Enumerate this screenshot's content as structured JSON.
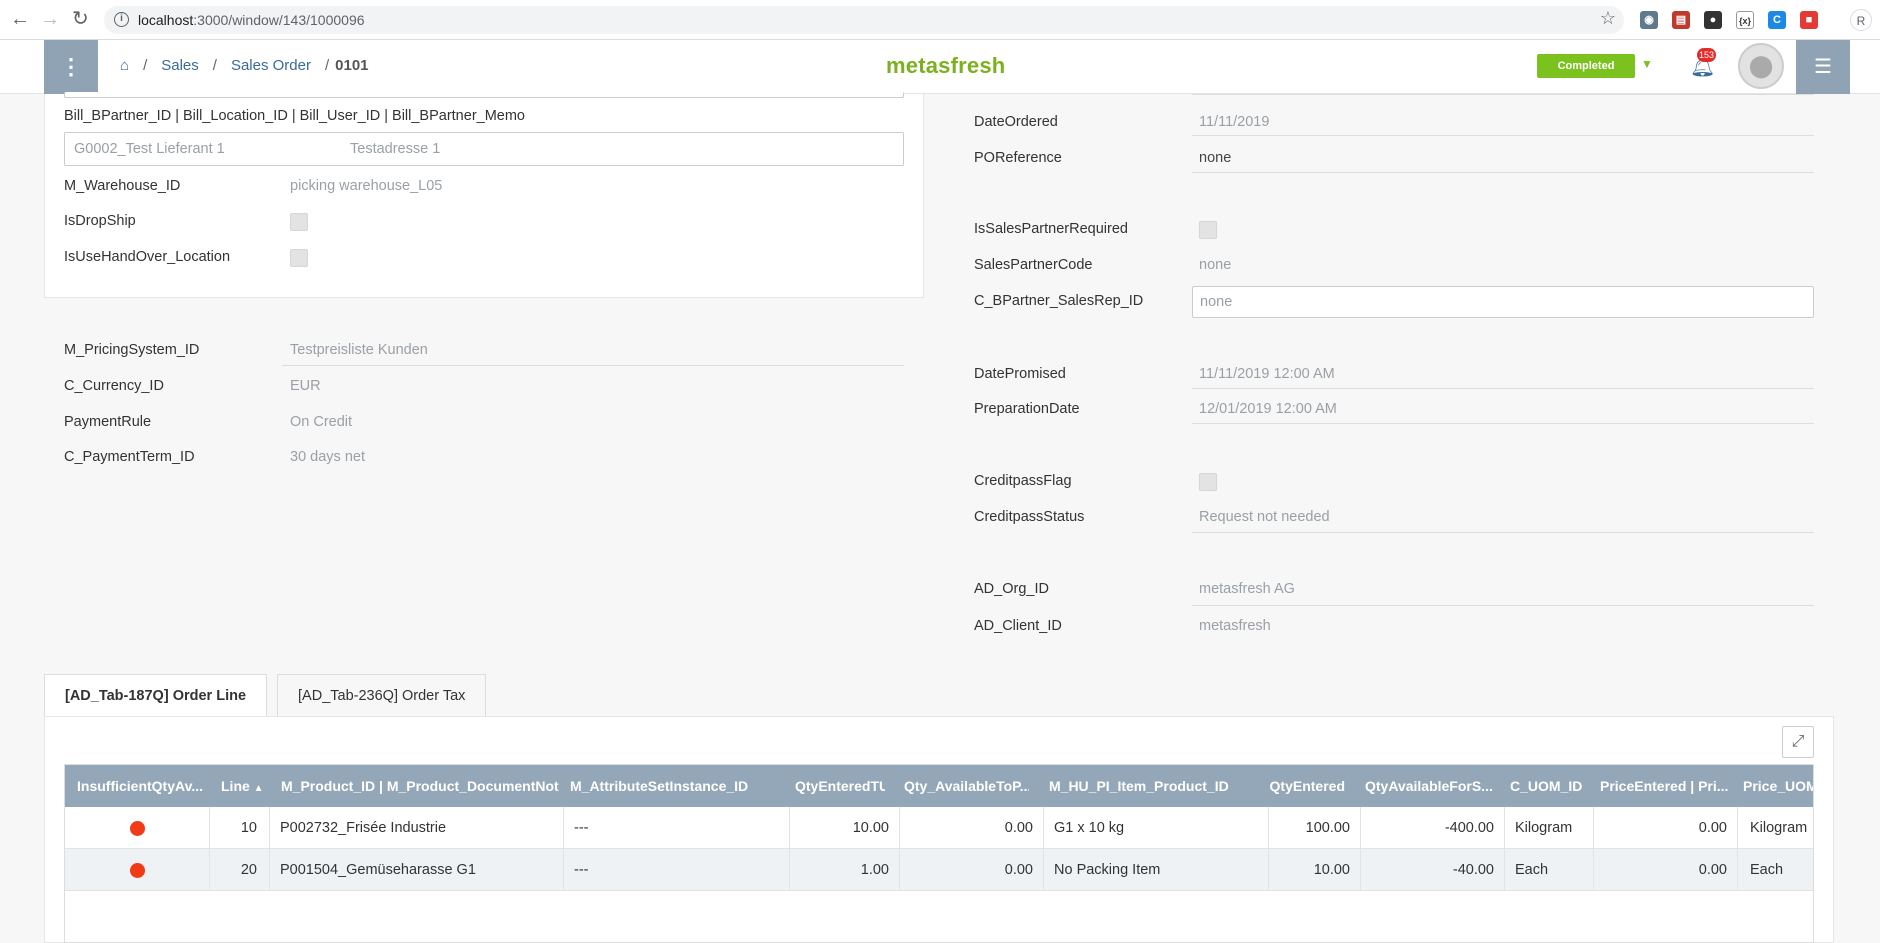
{
  "browser": {
    "url_host": "localhost",
    "url_path": ":3000/window/143/1000096",
    "profile_initial": "R"
  },
  "header": {
    "breadcrumb": [
      "Sales",
      "Sales Order"
    ],
    "record": "0101",
    "logo": "metasfresh",
    "status": "Completed",
    "notification_count": "153"
  },
  "left_form": {
    "bill_label": "Bill_BPartner_ID | Bill_Location_ID | Bill_User_ID | Bill_BPartner_Memo",
    "bill_partner": "G0002_Test Lieferant 1",
    "bill_location": "Testadresse 1",
    "warehouse_label": "M_Warehouse_ID",
    "warehouse_value": "picking warehouse_L05",
    "dropship_label": "IsDropShip",
    "handover_label": "IsUseHandOver_Location",
    "pricing_label": "M_PricingSystem_ID",
    "pricing_value": "Testpreisliste Kunden",
    "currency_label": "C_Currency_ID",
    "currency_value": "EUR",
    "paymentrule_label": "PaymentRule",
    "paymentrule_value": "On Credit",
    "paymentterm_label": "C_PaymentTerm_ID",
    "paymentterm_value": "30 days net"
  },
  "right_form": {
    "dateordered_label": "DateOrdered",
    "dateordered_value": "11/11/2019",
    "poreference_label": "POReference",
    "poreference_value": "none",
    "salespartnerreq_label": "IsSalesPartnerRequired",
    "salespartnercode_label": "SalesPartnerCode",
    "salespartnercode_value": "none",
    "salesrep_label": "C_BPartner_SalesRep_ID",
    "salesrep_value": "none",
    "datepromised_label": "DatePromised",
    "datepromised_value": "11/11/2019 12:00 AM",
    "prepdate_label": "PreparationDate",
    "prepdate_value": "12/01/2019 12:00 AM",
    "creditflag_label": "CreditpassFlag",
    "creditstatus_label": "CreditpassStatus",
    "creditstatus_value": "Request not needed",
    "org_label": "AD_Org_ID",
    "org_value": "metasfresh AG",
    "client_label": "AD_Client_ID",
    "client_value": "metasfresh"
  },
  "tabs": [
    {
      "label": "[AD_Tab-187Q] Order Line"
    },
    {
      "label": "[AD_Tab-236Q] Order Tax"
    }
  ],
  "grid": {
    "columns": [
      "InsufficientQtyAv...",
      "Line",
      "M_Product_ID | M_Product_DocumentNote",
      "M_AttributeSetInstance_ID",
      "QtyEnteredTU",
      "Qty_AvailableToP...",
      "M_HU_PI_Item_Product_ID",
      "QtyEntered",
      "QtyAvailableForS...",
      "C_UOM_ID",
      "PriceEntered | Pri...",
      "Price_UOM"
    ],
    "rows": [
      {
        "line": "10",
        "product": "P002732_Frisée Industrie",
        "asi": "---",
        "qty_tu": "10.00",
        "avail": "0.00",
        "hu": "G1 x 10 kg",
        "qty": "100.00",
        "avail_sale": "-400.00",
        "uom": "Kilogram",
        "price": "0.00",
        "price_uom": "Kilogram"
      },
      {
        "line": "20",
        "product": "P001504_Gemüseharasse G1",
        "asi": "---",
        "qty_tu": "1.00",
        "avail": "0.00",
        "hu": "No Packing Item",
        "qty": "10.00",
        "avail_sale": "-40.00",
        "uom": "Each",
        "price": "0.00",
        "price_uom": "Each"
      }
    ]
  },
  "colors": {
    "status": "#7bc21e",
    "header_btn": "#8fa3b5",
    "grid_header": "#94a7b8",
    "insufficient_dot": "#f03b16"
  }
}
